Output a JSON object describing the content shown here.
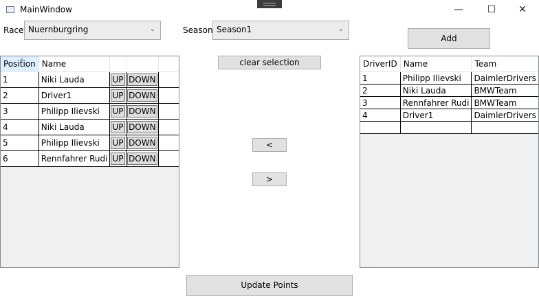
{
  "window": {
    "title": "MainWindow",
    "minimize": "—",
    "maximize": "☐",
    "close": "✕"
  },
  "race": {
    "label": "Race",
    "value": "Nuernburgring"
  },
  "season": {
    "label": "Season",
    "value": "Season1"
  },
  "buttons": {
    "add": "Add",
    "clear_selection": "clear selection",
    "move_left": "<",
    "move_right": ">",
    "update_points": "Update Points",
    "up": "UP",
    "down": "DOWN"
  },
  "results_grid": {
    "columns": [
      "Position",
      "Name"
    ],
    "rows": [
      {
        "position": "1",
        "name": "Niki Lauda"
      },
      {
        "position": "2",
        "name": "Driver1"
      },
      {
        "position": "3",
        "name": "Philipp Ilievski"
      },
      {
        "position": "4",
        "name": "Niki Lauda"
      },
      {
        "position": "5",
        "name": "Philipp Ilievski"
      },
      {
        "position": "6",
        "name": "Rennfahrer Rudi"
      }
    ]
  },
  "drivers_grid": {
    "columns": [
      "DriverID",
      "Name",
      "Team"
    ],
    "rows": [
      {
        "id": "1",
        "name": "Philipp Ilievski",
        "team": "DaimlerDrivers"
      },
      {
        "id": "2",
        "name": "Niki Lauda",
        "team": "BMWTeam"
      },
      {
        "id": "3",
        "name": "Rennfahrer Rudi",
        "team": "BMWTeam"
      },
      {
        "id": "4",
        "name": "Driver1",
        "team": "DaimlerDrivers"
      }
    ]
  }
}
